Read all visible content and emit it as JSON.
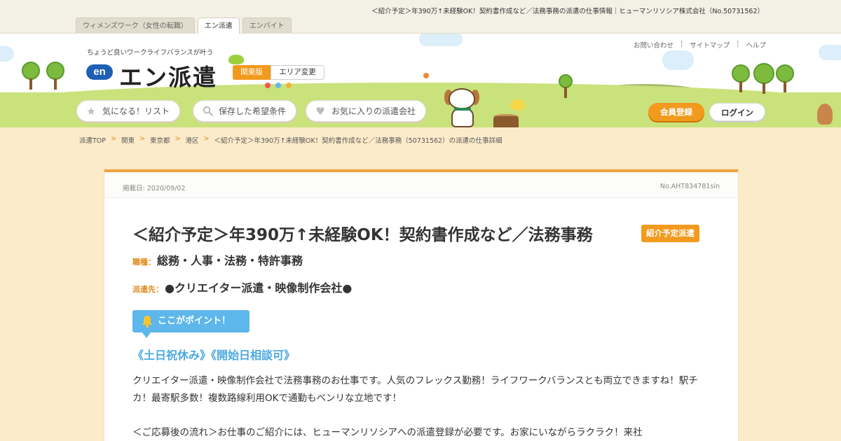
{
  "page_title": "＜紹介予定＞年390万↑未経験OK！契約書作成など／法務事務の派遣の仕事情報｜ヒューマンリソシア株式会社（No.50731562）",
  "site_tabs": [
    {
      "label": "ウィメンズワーク（女性の転職）",
      "active": false
    },
    {
      "label": "エン派遣",
      "active": true
    },
    {
      "label": "エンバイト",
      "active": false
    }
  ],
  "header": {
    "tagline": "ちょうど良いワークライフバランスが叶う",
    "logo_mark": "en",
    "logo_text": "エン派遣",
    "region_label": "関東版",
    "area_change_label": "エリア変更"
  },
  "utility_links": [
    "お問い合わせ",
    "サイトマップ",
    "ヘルプ"
  ],
  "nav": {
    "interest_list": "気になる！リスト",
    "saved_conditions": "保存した希望条件",
    "favorite_agencies": "お気に入りの派遣会社",
    "member_register": "会員登録",
    "login": "ログイン"
  },
  "breadcrumb": [
    "派遣TOP",
    "関東",
    "東京都",
    "港区",
    "＜紹介予定＞年390万↑未経験OK！契約書作成など／法務事務（50731562）の派遣の仕事詳細"
  ],
  "job": {
    "published_label": "掲載日:",
    "published_date": "2020/09/02",
    "job_no": "No.AHT834781sin",
    "title": "＜紹介予定＞年390万↑未経験OK！契約書作成など／法務事務",
    "badge": "紹介予定派遣",
    "category_label": "職種：",
    "category_value": "総務・人事・法務・特許事務",
    "dispatch_label": "派遣先：",
    "dispatch_value": "●クリエイター派遣・映像制作会社●",
    "point_label": "ここがポイント！",
    "highlight": "《土日祝休み》《開始日相談可》",
    "description_1": "クリエイター派遣・映像制作会社で法務事務のお仕事です。人気のフレックス勤務！ライフワークバランスとも両立できますね！駅チカ！最寄駅多数！複数路線利用OKで通勤もベンリな立地です！",
    "description_2": "＜ご応募後の流れ＞お仕事のご紹介には、ヒューマンリソシアへの派遣登録が必要です。お家にいながらラクラク！来社"
  },
  "colors": {
    "accent_orange": "#f29a1e",
    "point_blue": "#5db7ea",
    "background": "#fcebc9",
    "grass": "#c9e27c"
  }
}
